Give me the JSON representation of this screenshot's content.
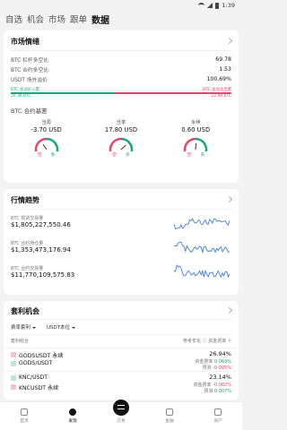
{
  "status": {
    "time": "1:39"
  },
  "nav": {
    "tabs": [
      "自选",
      "机会",
      "市场",
      "跟单",
      "数据"
    ],
    "active": "数据"
  },
  "market": {
    "title": "市场情绪",
    "rows": [
      {
        "label": "BTC 杠杆多空比",
        "value": "69.78"
      },
      {
        "label": "BTC 合约多空比",
        "value": "1.53"
      },
      {
        "label": "USDT 场外溢价",
        "value": "100.69%"
      }
    ],
    "ratio": {
      "buy_label": "BTC 主动买入量",
      "buy_value": "20.36 BTC",
      "sell_label": "BTC 主动卖出量",
      "sell_value": "22.98 BTC",
      "buy_fraction": 0.47
    },
    "basis_title": "BTC 合约基差",
    "gauges": [
      {
        "label": "当周",
        "value": "-3.70 USD",
        "level": 0.35
      },
      {
        "label": "当季",
        "value": "17.80 USD",
        "level": 0.7
      },
      {
        "label": "永续",
        "value": "0.60 USD",
        "level": 0.52
      }
    ],
    "gauge_ends": {
      "left": "空",
      "right": "多"
    },
    "colors": {
      "green": "#1aa57a",
      "red": "#e0456b"
    }
  },
  "trend": {
    "title": "行情趋势",
    "rows": [
      {
        "label": "BTC 现货交易量",
        "value": "$1,805,227,550.46"
      },
      {
        "label": "BTC 合约持仓量",
        "value": "$1,353,473,176.94"
      },
      {
        "label": "BTC 合约交易量",
        "value": "$11,770,109,575.83"
      }
    ]
  },
  "arb": {
    "title": "套利机会",
    "filters": [
      "费率套利",
      "USDT本位"
    ],
    "head_left": "套利组合",
    "head_right": "参考年化 ⓘ  资金费率 ↑",
    "pairs": [
      {
        "a": "GODSUSDT",
        "tag": "永续",
        "b": "GODS/USDT",
        "pct": "26.94%",
        "l1": "资金费率",
        "v1": "0.063%",
        "l2": "预测",
        "v2": "-0.095%",
        "c1": "#1aa57a",
        "c2": "#e0456b"
      },
      {
        "a": "KNC/USDT",
        "tag": "",
        "b": "KNCUSDT",
        "btag": "永续",
        "pct": "23.14%",
        "l1": "资金费率",
        "v1": "-0.062%",
        "l2": "预测",
        "v2": "0.007%",
        "c1": "#e0456b",
        "c2": "#1aa57a"
      }
    ]
  },
  "bottom": {
    "items": [
      "首页",
      "发现",
      "交易",
      "金融",
      "资产"
    ],
    "active": "发现"
  }
}
